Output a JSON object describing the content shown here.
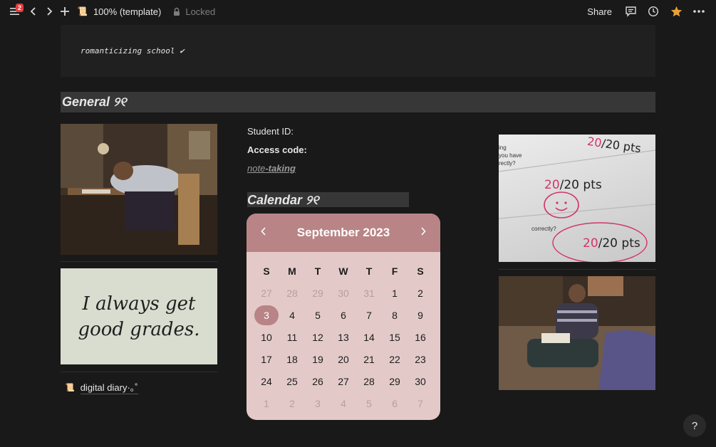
{
  "topbar": {
    "notification_count": "2",
    "breadcrumb_emoji": "📜",
    "page_title": "100% (template)",
    "locked_label": "Locked",
    "share_label": "Share"
  },
  "quote": {
    "text": "romanticizing school ✔"
  },
  "general_heading": "General ୨୧",
  "image_text_card": {
    "line1": "I always get",
    "line2": "good grades."
  },
  "scores": [
    {
      "score": "20",
      "total": "/20 pts"
    },
    {
      "score": "20",
      "total": "/20 pts"
    },
    {
      "score": "20",
      "total": "/20 pts"
    }
  ],
  "score_small_print": {
    "p1": "ing",
    "p2": "you have",
    "p3": "rectly?",
    "p4": "correctly?"
  },
  "properties": {
    "student_id": "Student ID:",
    "access_code": "Access code:",
    "note_prefix": "note",
    "note_suffix": "-taking"
  },
  "calendar_heading": "Calendar ୨୧",
  "calendar": {
    "month": "September 2023",
    "weekdays": [
      "S",
      "M",
      "T",
      "W",
      "T",
      "F",
      "S"
    ],
    "weeks": [
      [
        {
          "d": "27",
          "m": true
        },
        {
          "d": "28",
          "m": true
        },
        {
          "d": "29",
          "m": true
        },
        {
          "d": "30",
          "m": true
        },
        {
          "d": "31",
          "m": true
        },
        {
          "d": "1"
        },
        {
          "d": "2"
        }
      ],
      [
        {
          "d": "3",
          "t": true
        },
        {
          "d": "4"
        },
        {
          "d": "5"
        },
        {
          "d": "6"
        },
        {
          "d": "7"
        },
        {
          "d": "8"
        },
        {
          "d": "9"
        }
      ],
      [
        {
          "d": "10"
        },
        {
          "d": "11"
        },
        {
          "d": "12"
        },
        {
          "d": "13"
        },
        {
          "d": "14"
        },
        {
          "d": "15"
        },
        {
          "d": "16"
        }
      ],
      [
        {
          "d": "17"
        },
        {
          "d": "18"
        },
        {
          "d": "19"
        },
        {
          "d": "20"
        },
        {
          "d": "21"
        },
        {
          "d": "22"
        },
        {
          "d": "23"
        }
      ],
      [
        {
          "d": "24"
        },
        {
          "d": "25"
        },
        {
          "d": "26"
        },
        {
          "d": "27"
        },
        {
          "d": "28"
        },
        {
          "d": "29"
        },
        {
          "d": "30"
        }
      ],
      [
        {
          "d": "1",
          "m": true
        },
        {
          "d": "2",
          "m": true
        },
        {
          "d": "3",
          "m": true
        },
        {
          "d": "4",
          "m": true
        },
        {
          "d": "5",
          "m": true
        },
        {
          "d": "6",
          "m": true
        },
        {
          "d": "7",
          "m": true
        }
      ]
    ],
    "accent_color": "#b98485",
    "background_color": "#e3cac9"
  },
  "diary_link": {
    "emoji": "📜",
    "label": "digital diary·｡˚"
  },
  "help_label": "?"
}
